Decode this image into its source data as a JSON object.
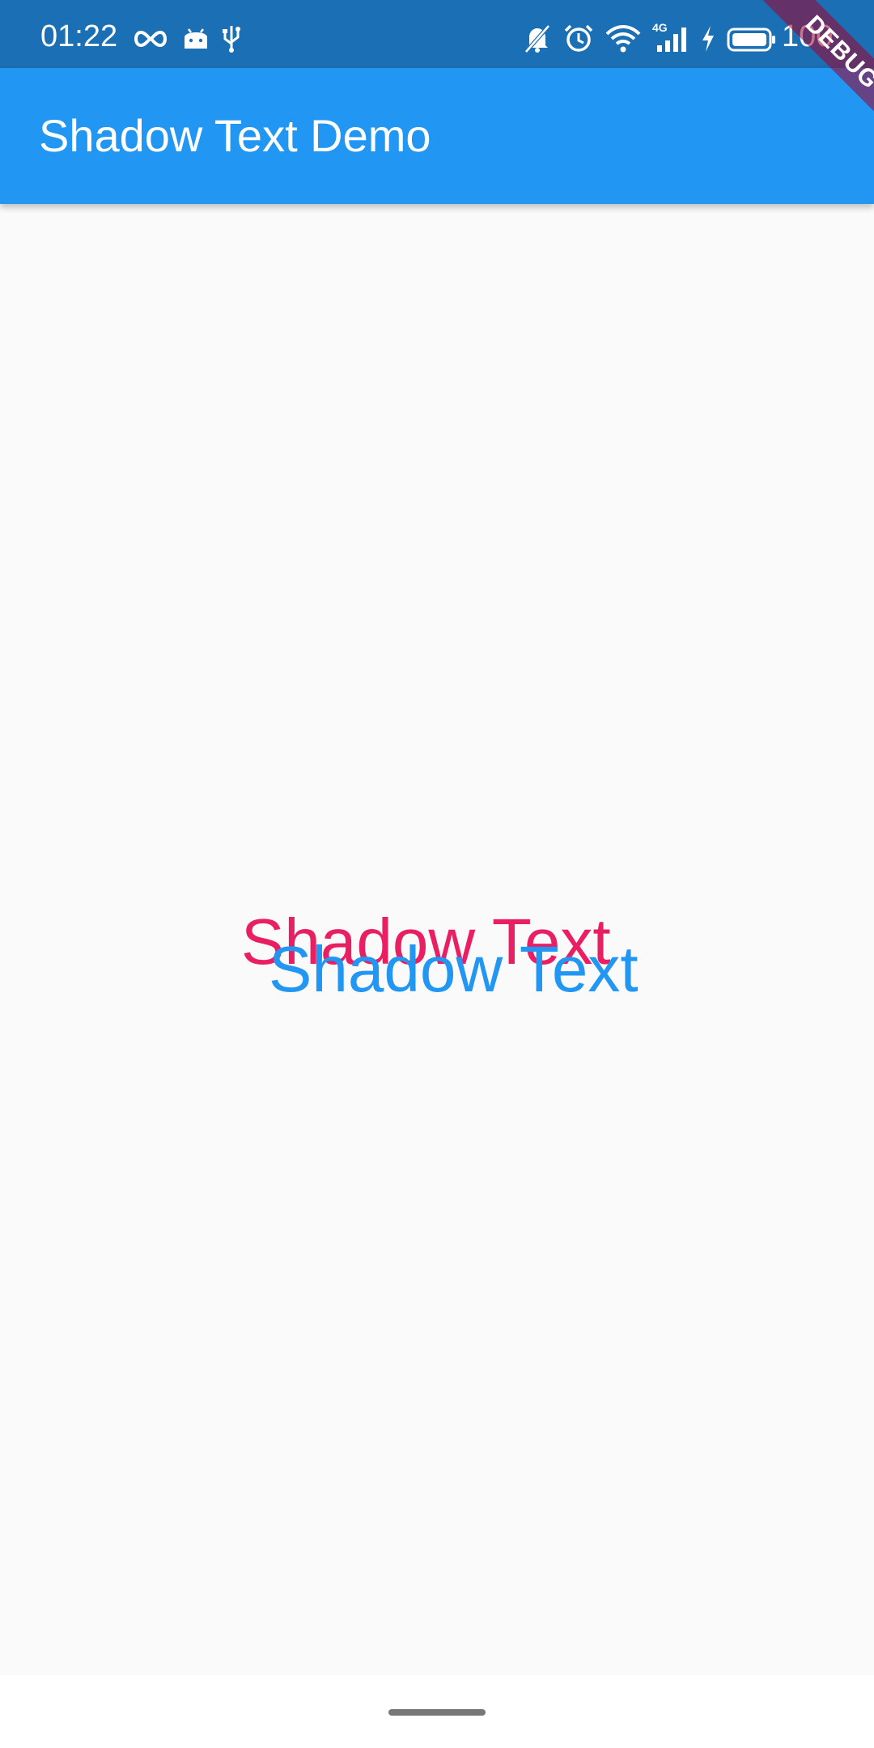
{
  "status_bar": {
    "time": "01:22",
    "battery_level": "100",
    "icons": [
      "infinity-icon",
      "android-icon",
      "usb-icon",
      "bell-off-icon",
      "alarm-icon",
      "wifi-icon",
      "signal-4g-icon",
      "charging-icon",
      "battery-icon"
    ],
    "signal_label": "4G"
  },
  "app_bar": {
    "title": "Shadow Text Demo"
  },
  "debug_banner": {
    "label": "DEBUG"
  },
  "content": {
    "shadow_text": "Shadow Text"
  },
  "colors": {
    "status_bar": "#1b6fb5",
    "app_bar": "#2196f3",
    "background": "#fafafa",
    "shadow_color": "#e91e63",
    "text_color": "#2196f3"
  }
}
